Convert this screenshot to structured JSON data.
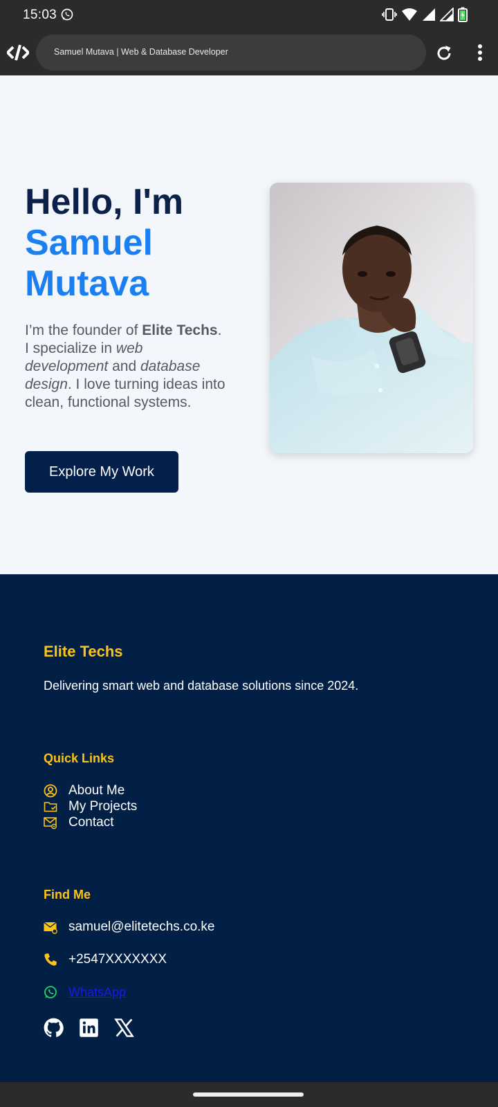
{
  "status_bar": {
    "time": "15:03"
  },
  "browser": {
    "page_title": "Samuel Mutava | Web & Database Developer"
  },
  "hero": {
    "greeting": "Hello, I'm",
    "name_first": "Samuel",
    "name_last": "Mutava",
    "intro": {
      "p1": "I’m the founder of ",
      "company": "Elite Techs",
      "p2": ". I specialize in ",
      "skill1": "web development",
      "p3": " and ",
      "skill2": "database design",
      "p4": ". I love turning ideas into clean, functional systems."
    },
    "cta_label": "Explore My Work"
  },
  "footer": {
    "brand": "Elite Techs",
    "tagline": "Delivering smart web and database solutions since 2024.",
    "quick_links_title": "Quick Links",
    "quick_links": [
      {
        "label": "About Me",
        "icon": "user-circle-icon"
      },
      {
        "label": "My Projects",
        "icon": "folder-icon"
      },
      {
        "label": "Contact",
        "icon": "envelope-at-icon"
      }
    ],
    "find_me_title": "Find Me",
    "email": "samuel@elitetechs.co.ke",
    "phone": "+2547XXXXXXX",
    "whatsapp_label": "WhatsApp",
    "socials": [
      "github-icon",
      "linkedin-icon",
      "x-icon"
    ]
  },
  "colors": {
    "navy": "#022046",
    "accent_blue": "#1a80f1",
    "gold": "#fcc419",
    "hero_bg": "#f3f6fa",
    "whatsapp_green": "#25d366"
  }
}
